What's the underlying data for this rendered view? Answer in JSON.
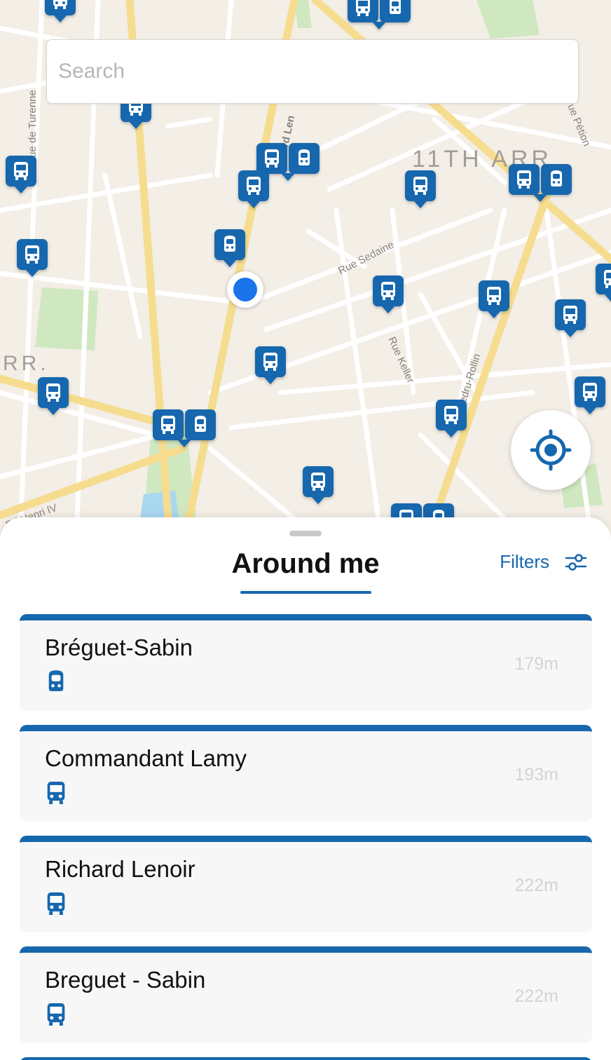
{
  "map": {
    "search_placeholder": "Search",
    "streets": [
      "Rue Sedaine",
      "Rue Keller",
      "Bd Henri IV",
      "ue de Turenne",
      "ue Pétion",
      "edru-Rollin",
      "rd Len",
      "ot"
    ],
    "districts": [
      "11TH ARR.",
      "RR."
    ],
    "colors": {
      "road_major": "#f6dc8e",
      "road_minor": "#ffffff",
      "park": "#cfe8c0",
      "stop": "#1667ae",
      "user": "#1a73e8"
    }
  },
  "sheet": {
    "title": "Around me",
    "filters_label": "Filters",
    "stops": [
      {
        "name": "Bréguet-Sabin",
        "distance": "179m",
        "mode_icon": "metro-icon"
      },
      {
        "name": "Commandant Lamy",
        "distance": "193m",
        "mode_icon": "bus-icon"
      },
      {
        "name": "Richard Lenoir",
        "distance": "222m",
        "mode_icon": "bus-icon"
      },
      {
        "name": "Breguet - Sabin",
        "distance": "222m",
        "mode_icon": "bus-icon"
      }
    ]
  }
}
